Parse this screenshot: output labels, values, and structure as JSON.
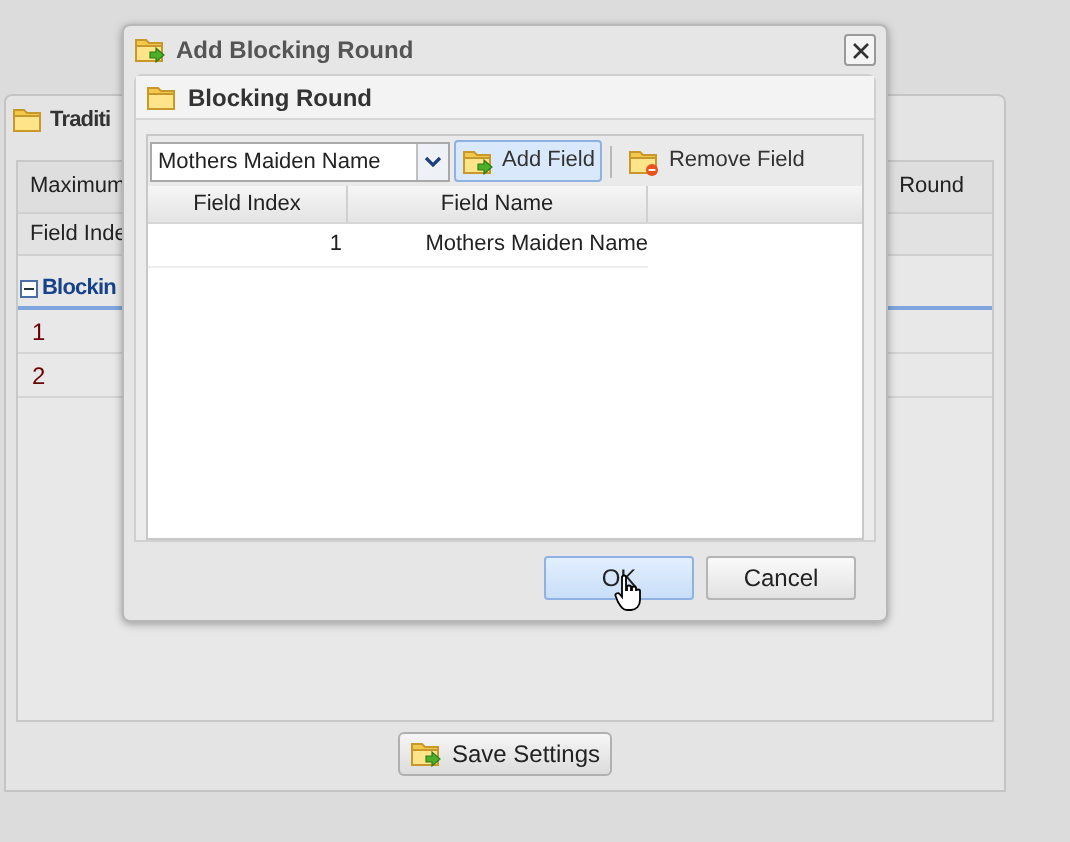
{
  "background_panel": {
    "title": "Traditi",
    "header_row": {
      "left": "Maximum",
      "right": "Round"
    },
    "column_header": "Field Inde",
    "group": {
      "label": "Blockin",
      "expanded": true
    },
    "rows": [
      "1",
      "2"
    ],
    "save_button": "Save Settings"
  },
  "dialog": {
    "title": "Add Blocking Round",
    "panel_title": "Blocking Round",
    "field_select": {
      "value": "Mothers Maiden Name"
    },
    "toolbar": [
      {
        "label": "Add Field",
        "kind": "add",
        "hovered": true
      },
      {
        "label": "Remove Field",
        "kind": "remove",
        "hovered": false
      }
    ],
    "columns": [
      "Field Index",
      "Field Name"
    ],
    "rows": [
      {
        "field_index": "1",
        "field_name": "Mothers Maiden Name"
      }
    ],
    "buttons": [
      {
        "label": "OK",
        "hovered": true
      },
      {
        "label": "Cancel",
        "hovered": false
      }
    ]
  }
}
